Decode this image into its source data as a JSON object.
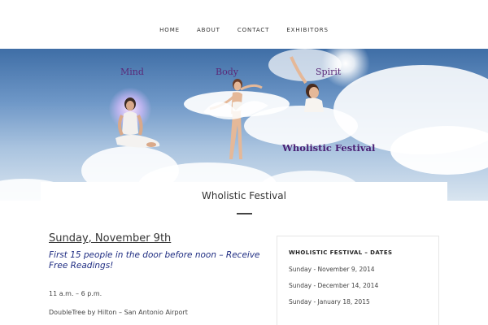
{
  "nav": {
    "items": [
      "HOME",
      "ABOUT",
      "CONTACT",
      "EXHIBITORS"
    ]
  },
  "hero": {
    "words": [
      "Mind",
      "Body",
      "Spirit"
    ],
    "title": "Wholistic Festival"
  },
  "page": {
    "title": "Wholistic Festival"
  },
  "main": {
    "date_heading": "Sunday, November 9th",
    "promo": "First 15 people in the door before noon – Receive Free Readings!",
    "hours": "11 a.m. – 6 p.m.",
    "venue": "DoubleTree by Hilton – San Antonio Airport"
  },
  "sidebar": {
    "widget_title": "WHOLISTIC FESTIVAL – DATES",
    "dates": [
      "Sunday - November 9, 2014",
      "Sunday - December 14, 2014",
      "Sunday - January 18, 2015"
    ]
  },
  "colors": {
    "promo_text": "#1f2d82",
    "hero_text": "#5a2878",
    "sky_top": "#3f6ea6"
  }
}
